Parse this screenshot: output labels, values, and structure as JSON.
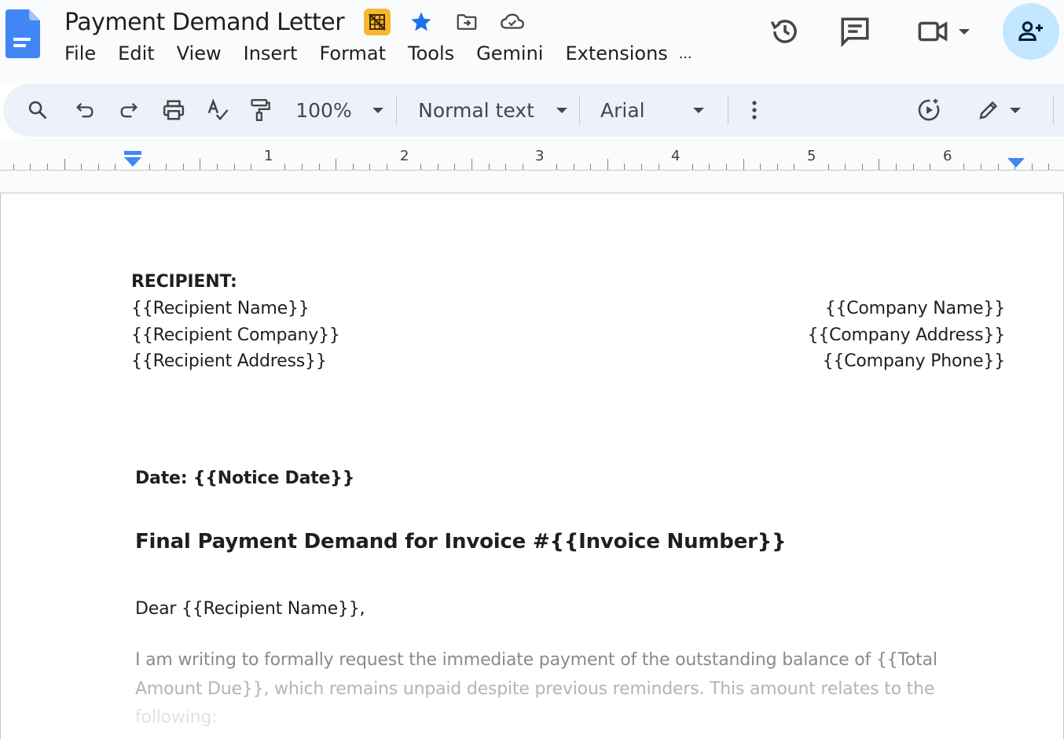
{
  "header": {
    "title": "Payment Demand Letter",
    "menu": [
      "File",
      "Edit",
      "View",
      "Insert",
      "Format",
      "Tools",
      "Gemini",
      "Extensions"
    ],
    "menu_more": "..."
  },
  "toolbar": {
    "zoom": "100%",
    "style": "Normal text",
    "font": "Arial"
  },
  "ruler": {
    "numbers": [
      "1",
      "2",
      "3",
      "4",
      "5",
      "6"
    ]
  },
  "document": {
    "recipient_label": "RECIPIENT:",
    "recipient_name": "{{Recipient Name}}",
    "recipient_company": "{{Recipient Company}}",
    "recipient_address": "{{Recipient Address}}",
    "company_name": "{{Company Name}}",
    "company_address": "{{Company Address}}",
    "company_phone": "{{Company Phone}}",
    "date_line": "Date: {{Notice Date}}",
    "heading": "Final Payment Demand for Invoice #{{Invoice Number}}",
    "salutation": "Dear {{Recipient Name}},",
    "body_line1": "I am writing to formally request the immediate payment of the outstanding balance of {{Total",
    "body_line2": "Amount Due}}, which remains unpaid despite previous reminders. This amount relates to the",
    "body_line3": "following:"
  },
  "colors": {
    "accent": "#4285f4",
    "share_bg": "#c2e7ff",
    "toolbar_bg": "#edf2fa",
    "header_bg": "#f9fbfd"
  }
}
